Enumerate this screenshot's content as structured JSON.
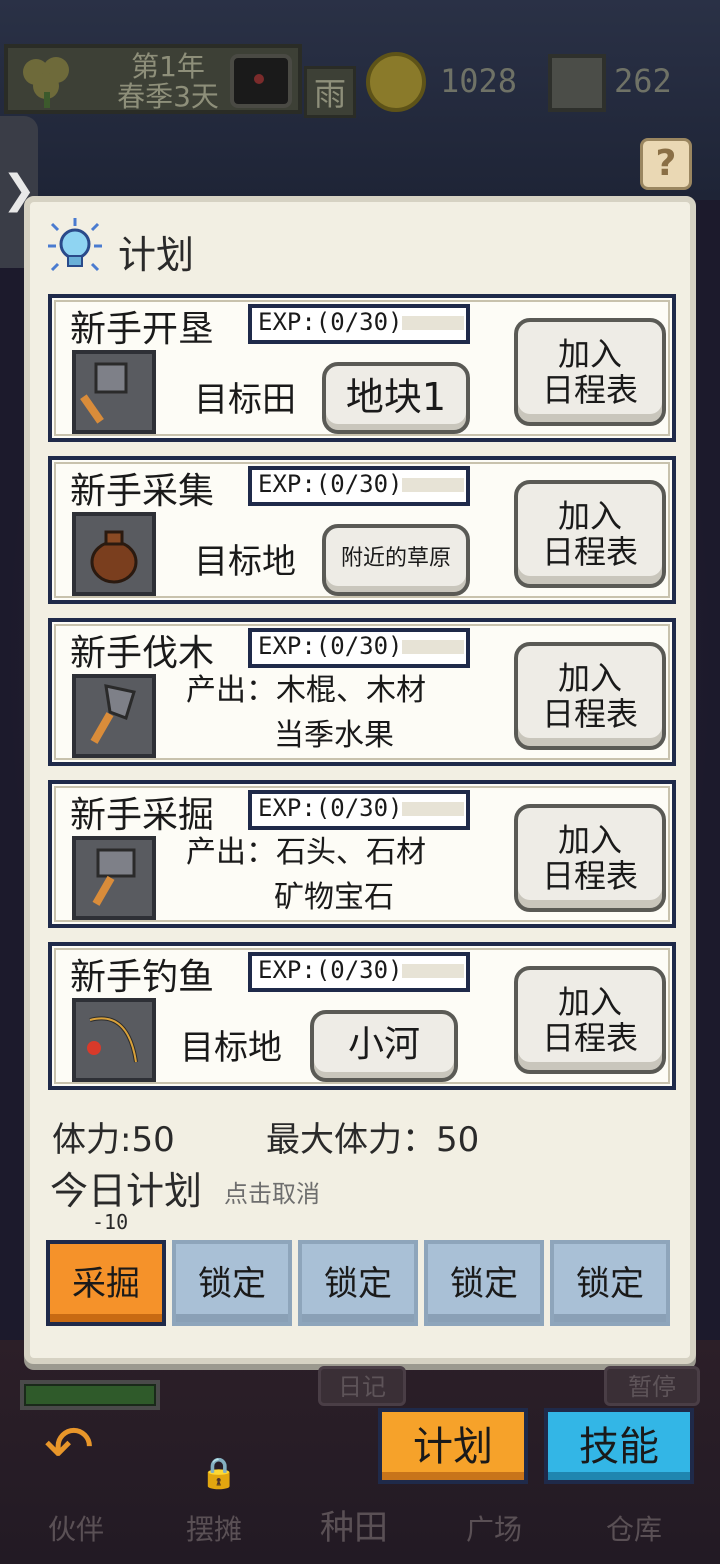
{
  "hud": {
    "date_line1": "第1年",
    "date_line2": "春季3天",
    "weather": "雨",
    "coins": "1028",
    "gems": "262"
  },
  "side_tab": {
    "icon": "chevron-right-icon",
    "glyph": "❯"
  },
  "help": {
    "glyph": "?"
  },
  "panel": {
    "title": "计划",
    "tasks": [
      {
        "name": "新手开垦",
        "exp": "EXP:(0/30)",
        "exp_fraction": 0,
        "icon": "hoe-icon",
        "target_label": "目标田",
        "target_value": "地块1",
        "add_line1": "加入",
        "add_line2": "日程表"
      },
      {
        "name": "新手采集",
        "exp": "EXP:(0/30)",
        "exp_fraction": 0,
        "icon": "sack-icon",
        "target_label": "目标地",
        "target_value": "附近的草原",
        "add_line1": "加入",
        "add_line2": "日程表"
      },
      {
        "name": "新手伐木",
        "exp": "EXP:(0/30)",
        "exp_fraction": 0,
        "icon": "axe-icon",
        "output_line1": "产出：木棍、木材",
        "output_line2": "当季水果",
        "add_line1": "加入",
        "add_line2": "日程表"
      },
      {
        "name": "新手采掘",
        "exp": "EXP:(0/30)",
        "exp_fraction": 0,
        "icon": "hammer-icon",
        "output_line1": "产出：石头、石材",
        "output_line2": "矿物宝石",
        "add_line1": "加入",
        "add_line2": "日程表"
      },
      {
        "name": "新手钓鱼",
        "exp": "EXP:(0/30)",
        "exp_fraction": 0,
        "icon": "fishing-rod-icon",
        "target_label": "目标地",
        "target_value": "小河",
        "add_line1": "加入",
        "add_line2": "日程表"
      }
    ],
    "stamina": "体力:50",
    "max_stamina": "最大体力：50",
    "today_plan": "今日计划",
    "cancel_hint": "点击取消",
    "cost": "-10",
    "slots": [
      {
        "label": "采掘",
        "state": "active"
      },
      {
        "label": "锁定",
        "state": "locked"
      },
      {
        "label": "锁定",
        "state": "locked"
      },
      {
        "label": "锁定",
        "state": "locked"
      },
      {
        "label": "锁定",
        "state": "locked"
      }
    ]
  },
  "bottom": {
    "diary": "日记",
    "pause": "暂停",
    "partner": "伙伴",
    "stall": "摆摊",
    "farm": "种田",
    "plaza": "广场",
    "warehouse": "仓库",
    "plan": "计划",
    "skill": "技能"
  },
  "colors": {
    "panel_bg": "#f2efe3",
    "active_slot": "#f5922a",
    "locked_slot": "#a9c0d6",
    "plan_button": "#f6a22a",
    "skill_button": "#33b6e6",
    "border_navy": "#1f2a4a"
  }
}
